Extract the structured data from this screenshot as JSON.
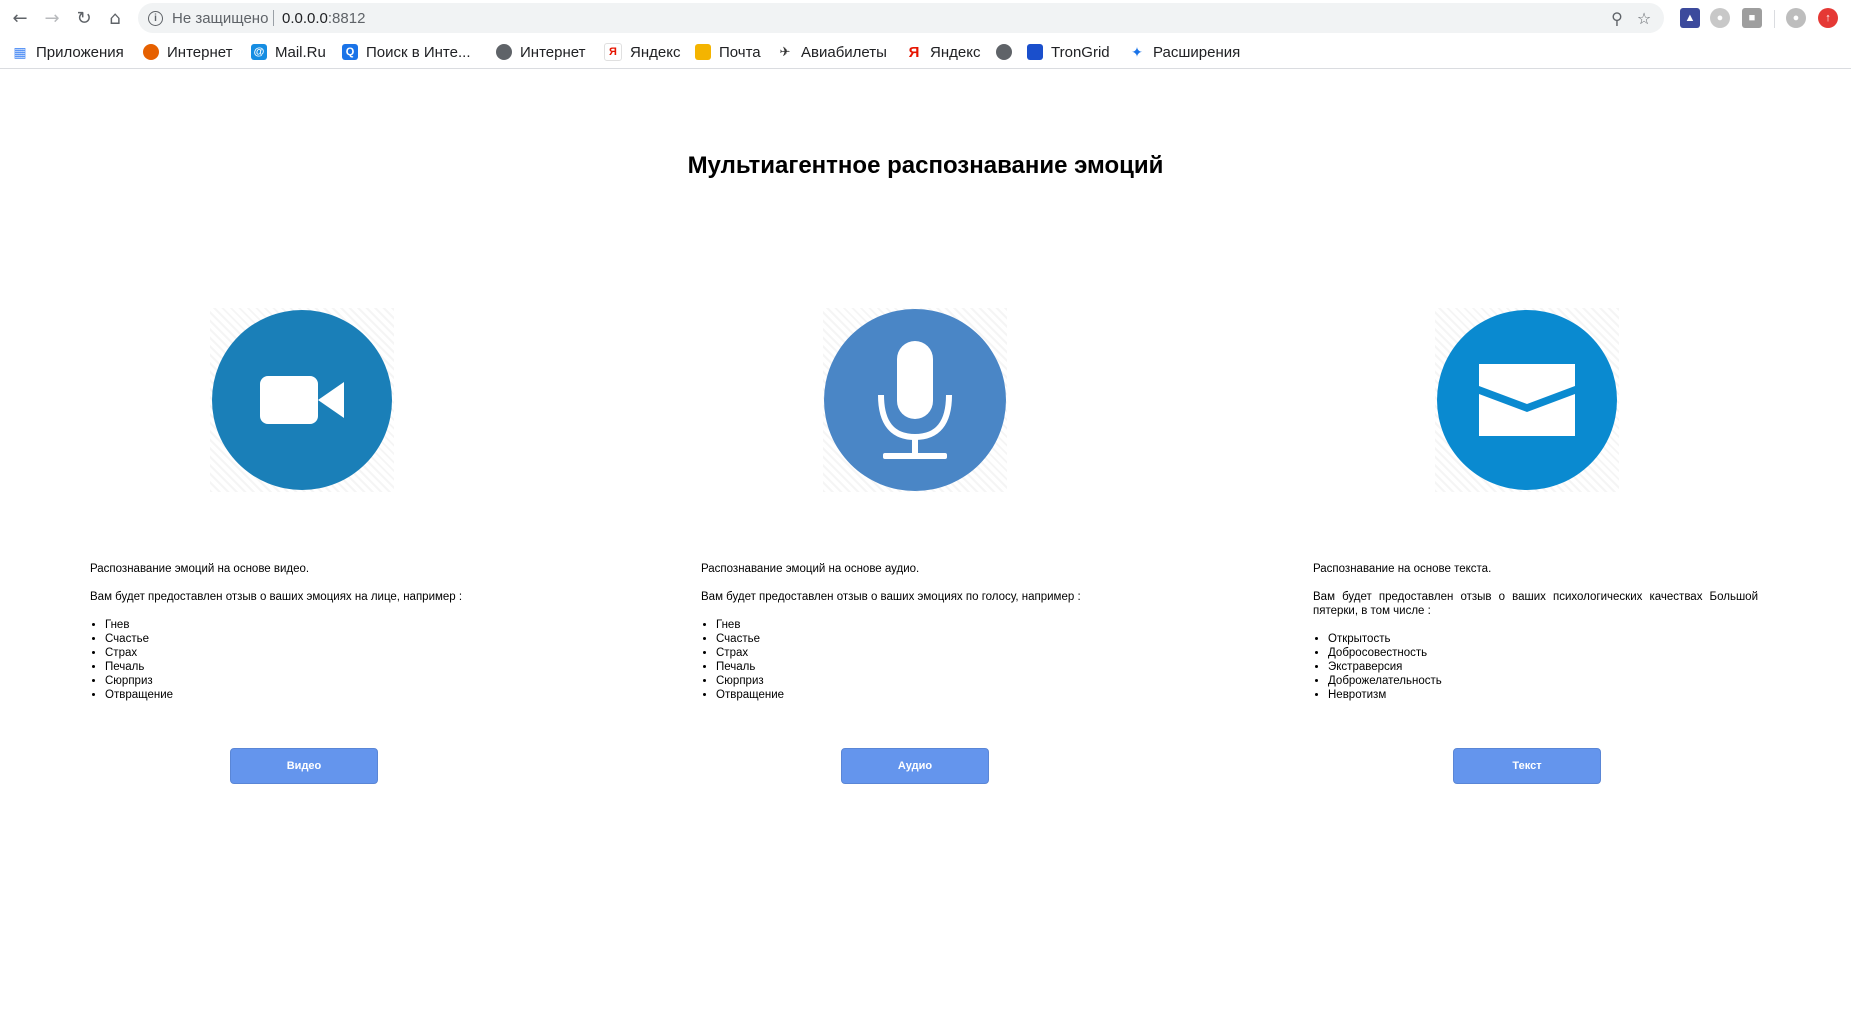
{
  "browser": {
    "security_label": "Не защищено",
    "url_host": "0.0.0.0",
    "url_port": ":8812",
    "icons": [
      "back-arrow-icon",
      "forward-arrow-icon",
      "reload-icon",
      "home-icon",
      "info-icon",
      "zoom-icon",
      "star-icon",
      "profile-icon"
    ]
  },
  "bookmarks": [
    {
      "label": "Приложения",
      "icon": "apps-grid-icon",
      "color": "#4285f4"
    },
    {
      "label": "Интернет",
      "icon": "firefox-icon",
      "color": "#e66000"
    },
    {
      "label": "Mail.Ru",
      "icon": "mailru-icon",
      "color": "#168de2"
    },
    {
      "label": "Поиск в Инте...",
      "icon": "search-icon",
      "color": "#1a73e8"
    },
    {
      "label": "Интернет",
      "icon": "globe-icon",
      "color": "#5f6368"
    },
    {
      "label": "Яндекс",
      "icon": "yandex-icon",
      "color": "#e61400"
    },
    {
      "label": "Почта",
      "icon": "mail-icon",
      "color": "#f4b400"
    },
    {
      "label": "Авиабилеты",
      "icon": "plane-icon",
      "color": "#f4b400"
    },
    {
      "label": "Яндекс",
      "icon": "yandex-letter-icon",
      "color": "#e61400"
    },
    {
      "label": "",
      "icon": "globe-icon",
      "color": "#5f6368"
    },
    {
      "label": "TronGrid",
      "icon": "trongrid-icon",
      "color": "#1a4fcc"
    },
    {
      "label": "Расширения",
      "icon": "puzzle-icon",
      "color": "#1a73e8"
    }
  ],
  "page": {
    "title": "Мультиагентное распознавание эмоций",
    "cards": [
      {
        "key": "video",
        "icon": "video-camera-icon",
        "circle_color": "#1a7fb8",
        "heading": "Распознавание эмоций на основе видео.",
        "intro": "Вам будет предоставлен отзыв о ваших эмоциях на лице, например :",
        "items": [
          "Гнев",
          "Счастье",
          "Страх",
          "Печаль",
          "Сюрприз",
          "Отвращение"
        ],
        "button": "Видео"
      },
      {
        "key": "audio",
        "icon": "microphone-icon",
        "circle_color": "#4a86c6",
        "heading": "Распознавание эмоций на основе аудио.",
        "intro": "Вам будет предоставлен отзыв о ваших эмоциях по голосу, например :",
        "items": [
          "Гнев",
          "Счастье",
          "Страх",
          "Печаль",
          "Сюрприз",
          "Отвращение"
        ],
        "button": "Аудио"
      },
      {
        "key": "text",
        "icon": "envelope-icon",
        "circle_color": "#0a8ad0",
        "heading": "Распознавание на основе текста.",
        "intro": "Вам будет предоставлен отзыв о ваших психологических качествах Большой пятерки, в том числе :",
        "items": [
          "Открытость",
          "Добросовестность",
          "Экстраверсия",
          "Доброжелательность",
          "Невротизм"
        ],
        "button": "Текст"
      }
    ]
  }
}
